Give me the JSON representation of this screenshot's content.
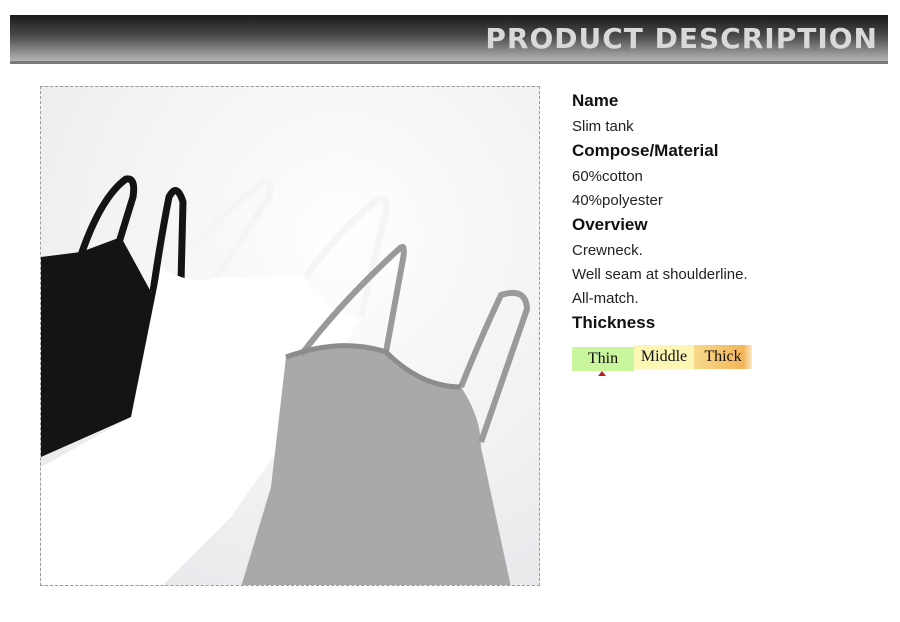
{
  "banner": {
    "title": "PRODUCT DESCRIPTION"
  },
  "description": {
    "name_heading": "Name",
    "name_value": "Slim tank",
    "material_heading": "Compose/Material",
    "material_lines": [
      "60%cotton",
      "40%polyester"
    ],
    "overview_heading": "Overview",
    "overview_lines": [
      "Crewneck.",
      "Well seam at shoulderline.",
      "All-match."
    ],
    "thickness_heading": "Thickness",
    "thickness_options": [
      "Thin",
      "Middle",
      "Thick"
    ],
    "thickness_selected": "Thin"
  },
  "colors": {
    "thin": "#c9f59d",
    "middle": "#fbf6b3",
    "thick": "#f4b55a",
    "marker": "#b22222"
  }
}
